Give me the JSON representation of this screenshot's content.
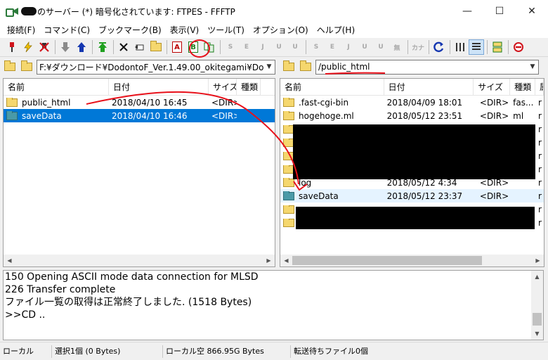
{
  "window": {
    "title": "のサーバー (*) 暗号化されています: FTPES - FFFTP",
    "minimize_label": "—",
    "maximize_label": "☐",
    "close_label": "✕"
  },
  "menu": [
    {
      "label": "接続(F)"
    },
    {
      "label": "コマンド(C)"
    },
    {
      "label": "ブックマーク(B)"
    },
    {
      "label": "表示(V)"
    },
    {
      "label": "ツール(T)"
    },
    {
      "label": "オプション(O)"
    },
    {
      "label": "ヘルプ(H)"
    }
  ],
  "toolbar": {
    "ascii_label": "A",
    "binary_label": "B",
    "dim_labels": [
      "S",
      "E",
      "J",
      "U",
      "U",
      "S",
      "E",
      "J",
      "U",
      "U",
      "無",
      "カナ"
    ]
  },
  "local": {
    "path": "F:¥ダウンロード¥DodontoF_Ver.1.49.00_okitegami¥Dodo",
    "columns": [
      "名前",
      "日付",
      "サイズ",
      "種類"
    ],
    "files": [
      {
        "name": "public_html",
        "date": "2018/04/10 16:45",
        "size": "<DIR>",
        "type": "",
        "folder": "yellow"
      },
      {
        "name": "saveData",
        "date": "2018/04/10 16:46",
        "size": "<DIR>",
        "type": "",
        "folder": "teal"
      }
    ]
  },
  "remote": {
    "path": "/public_html",
    "columns": [
      "名前",
      "日付",
      "サイズ",
      "種類",
      "属"
    ],
    "files": [
      {
        "name": ".fast-cgi-bin",
        "date": "2018/04/09 18:01",
        "size": "<DIR>",
        "type": "fas...",
        "attr": "r",
        "folder": "yellow"
      },
      {
        "name": "hogehoge.ml",
        "date": "2018/05/12 23:51",
        "size": "<DIR>",
        "type": "ml",
        "attr": "r",
        "folder": "yellow"
      },
      {
        "name": "",
        "date": "",
        "size": "",
        "type": "",
        "attr": "r",
        "folder": "yellow"
      },
      {
        "name": "",
        "date": "",
        "size": "",
        "type": "",
        "attr": "r",
        "folder": "yellow"
      },
      {
        "name": "",
        "date": "",
        "size": "",
        "type": "",
        "attr": "r",
        "folder": "yellow"
      },
      {
        "name": "",
        "date": "",
        "size": "",
        "type": "",
        "attr": "r",
        "folder": "yellow"
      },
      {
        "name": "log",
        "date": "2018/05/12  4:34",
        "size": "<DIR>",
        "type": "",
        "attr": "r",
        "folder": "yellow"
      },
      {
        "name": "saveData",
        "date": "2018/05/12 23:37",
        "size": "<DIR>",
        "type": "",
        "attr": "r",
        "folder": "teal"
      },
      {
        "name": "",
        "date": "",
        "size": "",
        "type": "",
        "attr": "r",
        "folder": "yellow"
      },
      {
        "name": "",
        "date": "",
        "size": "",
        "type": "",
        "attr": "r",
        "folder": "yellow"
      }
    ]
  },
  "log": [
    "150 Opening ASCII mode data connection for MLSD",
    "226 Transfer complete",
    "ファイル一覧の取得は正常終了しました. (1518 Bytes)",
    ">>CD .."
  ],
  "status": {
    "side": "ローカル",
    "selection": "選択1個  (0 Bytes)",
    "free": "ローカル空 866.95G Bytes",
    "queue": "転送待ちファイル0個"
  },
  "colors": {
    "selection": "#0078d7",
    "annotation": "#e8101a"
  }
}
